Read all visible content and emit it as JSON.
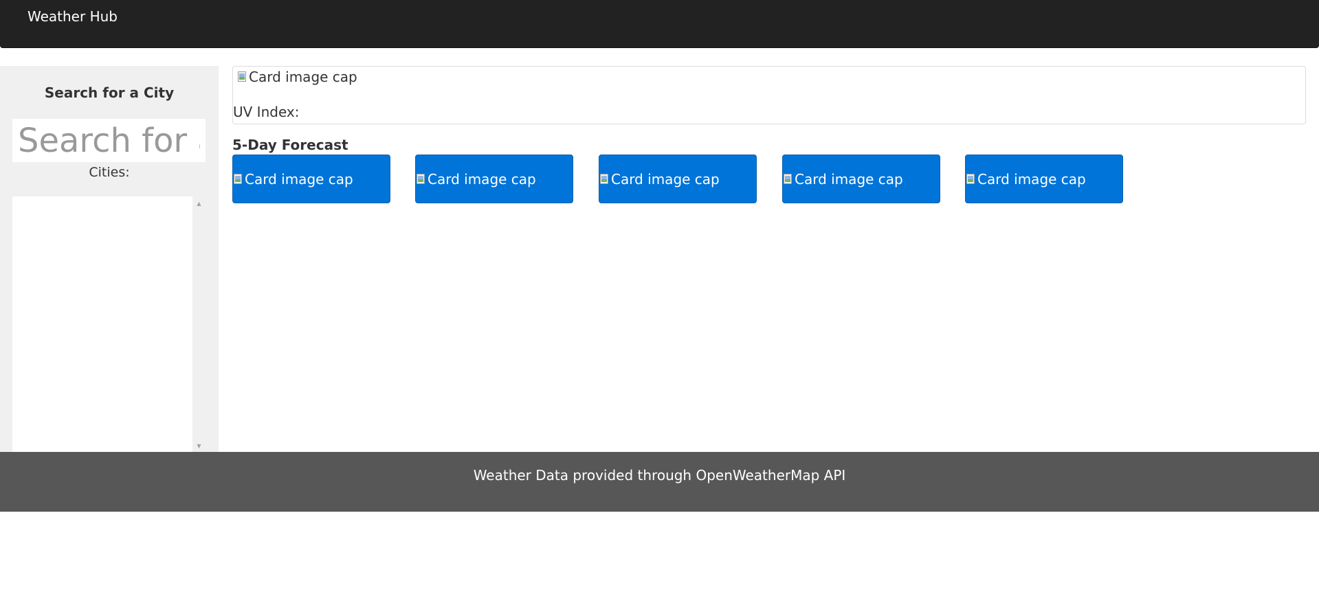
{
  "navbar": {
    "brand": "Weather Hub"
  },
  "sidebar": {
    "title": "Search for a City",
    "search_placeholder": "Search for a City",
    "cities_label": "Cities:",
    "cities": []
  },
  "current": {
    "image_alt": "Card image cap",
    "uv_label": "UV Index:"
  },
  "forecast": {
    "title": "5-Day Forecast",
    "cards": [
      {
        "image_alt": "Card image cap"
      },
      {
        "image_alt": "Card image cap"
      },
      {
        "image_alt": "Card image cap"
      },
      {
        "image_alt": "Card image cap"
      },
      {
        "image_alt": "Card image cap"
      }
    ]
  },
  "footer": {
    "text": "Weather Data provided through OpenWeatherMap API"
  },
  "colors": {
    "navbar_bg": "#222222",
    "sidebar_bg": "#f0f0f0",
    "forecast_card_bg": "#0074d9",
    "footer_bg": "#575757"
  },
  "icons": {
    "broken_image": "broken-image-icon",
    "scroll_up": "scroll-up-arrow-icon",
    "scroll_down": "scroll-down-arrow-icon"
  }
}
